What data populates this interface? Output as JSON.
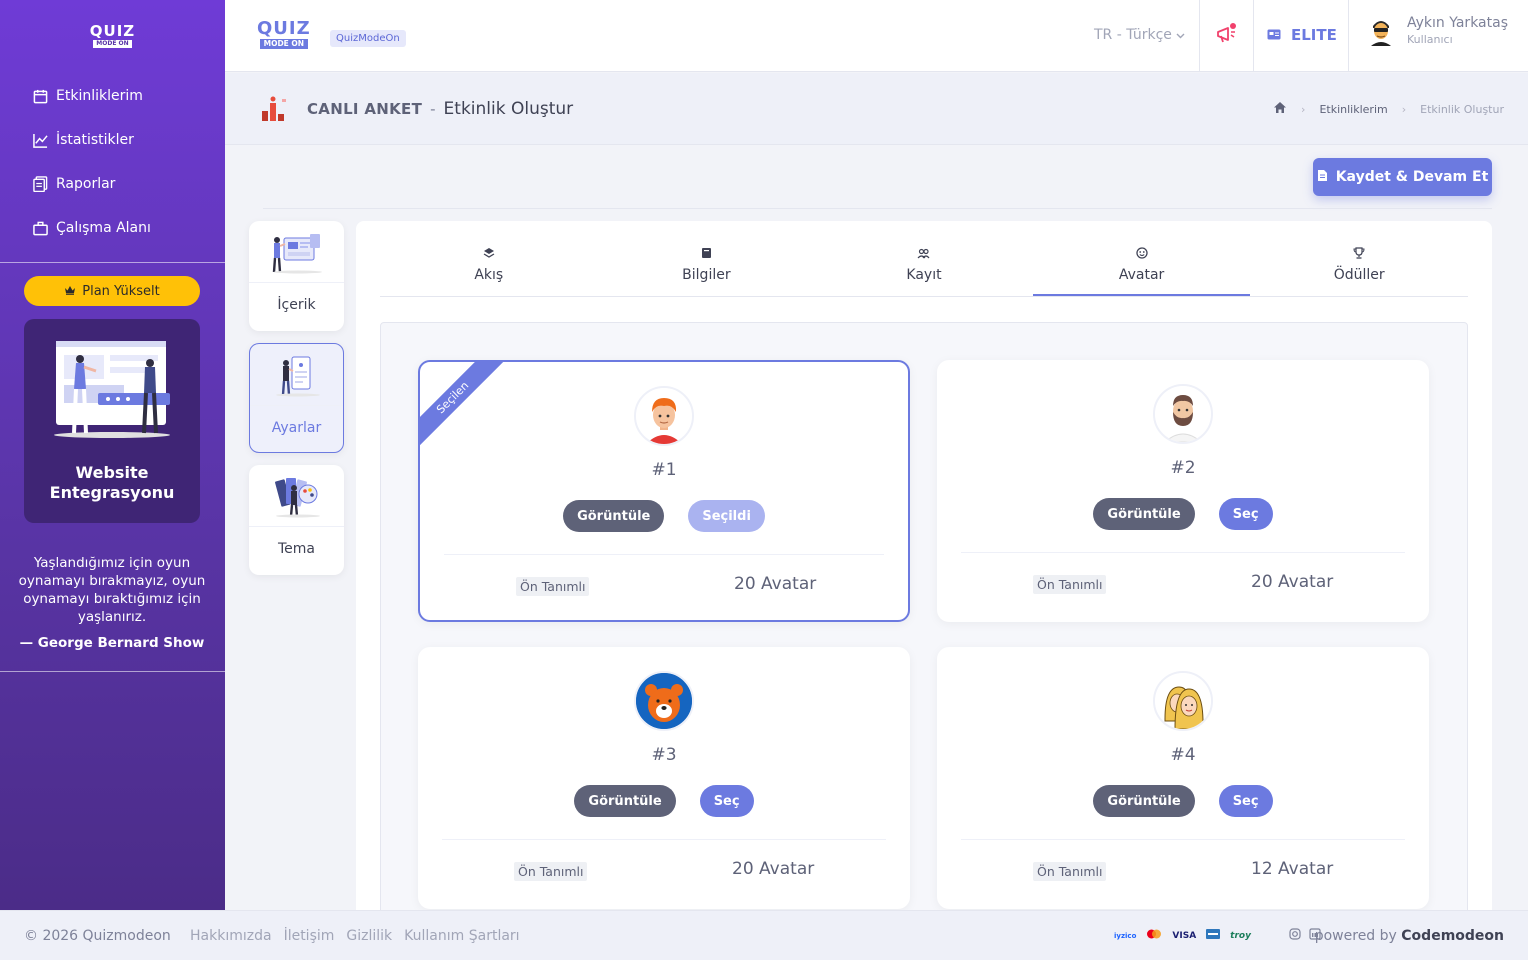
{
  "sidebar": {
    "logo_top": "QUIZ",
    "logo_bottom": "MODE ON",
    "items": [
      {
        "label": "Etkinliklerim",
        "icon": "calendar-icon"
      },
      {
        "label": "İstatistikler",
        "icon": "line-chart-icon"
      },
      {
        "label": "Raporlar",
        "icon": "document-icon"
      },
      {
        "label": "Çalışma Alanı",
        "icon": "briefcase-icon"
      }
    ],
    "plan_button": "Plan Yükselt",
    "promo_title": "Website Entegrasyonu",
    "quote": "Yaşlandığımız için oyun oynamayı bırakmayız, oyun oynamayı bıraktığımız için yaşlanırız.",
    "quote_author": "— George Bernard Show"
  },
  "topbar": {
    "logo_top": "QUIZ",
    "logo_bottom": "MODE ON",
    "badge": "QuizModeOn",
    "language": "TR - Türkçe",
    "plan": "ELITE",
    "user_name": "Aykın Yarkataş",
    "user_role": "Kullanıcı"
  },
  "subheader": {
    "type": "CANLI ANKET",
    "separator": "-",
    "title": "Etkinlik Oluştur",
    "breadcrumb": [
      "Etkinliklerim",
      "Etkinlik Oluştur"
    ]
  },
  "save_button": "Kaydet & Devam Et",
  "side_tabs": [
    {
      "label": "İçerik",
      "active": false
    },
    {
      "label": "Ayarlar",
      "active": true
    },
    {
      "label": "Tema",
      "active": false
    }
  ],
  "tabs": [
    {
      "label": "Akış",
      "icon": "layers-icon"
    },
    {
      "label": "Bilgiler",
      "icon": "book-icon"
    },
    {
      "label": "Kayıt",
      "icon": "users-icon"
    },
    {
      "label": "Avatar",
      "icon": "smile-icon",
      "active": true
    },
    {
      "label": "Ödüller",
      "icon": "trophy-icon"
    }
  ],
  "avatar_sets": [
    {
      "number": "#1",
      "view": "Görüntüle",
      "select": "Seçildi",
      "selected": true,
      "ribbon": "Seçilen",
      "tag": "Ön Tanımlı",
      "count": "20 Avatar"
    },
    {
      "number": "#2",
      "view": "Görüntüle",
      "select": "Seç",
      "selected": false,
      "tag": "Ön Tanımlı",
      "count": "20 Avatar"
    },
    {
      "number": "#3",
      "view": "Görüntüle",
      "select": "Seç",
      "selected": false,
      "tag": "Ön Tanımlı",
      "count": "20 Avatar"
    },
    {
      "number": "#4",
      "view": "Görüntüle",
      "select": "Seç",
      "selected": false,
      "tag": "Ön Tanımlı",
      "count": "12 Avatar"
    }
  ],
  "footer": {
    "copyright": "© 2026 Quizmodeon",
    "links": [
      "Hakkımızda",
      "İletişim",
      "Gizlilik",
      "Kullanım Şartları"
    ],
    "payments": [
      "iyzico",
      "mastercard",
      "VISA",
      "amex",
      "troy"
    ],
    "powered_prefix": "powered by",
    "powered_brand": "Codemodeon"
  },
  "colors": {
    "accent": "#6c7ae0",
    "sidebar": "#5a35a8",
    "plan_button": "#ffc107",
    "dark_button": "#5e6278"
  }
}
